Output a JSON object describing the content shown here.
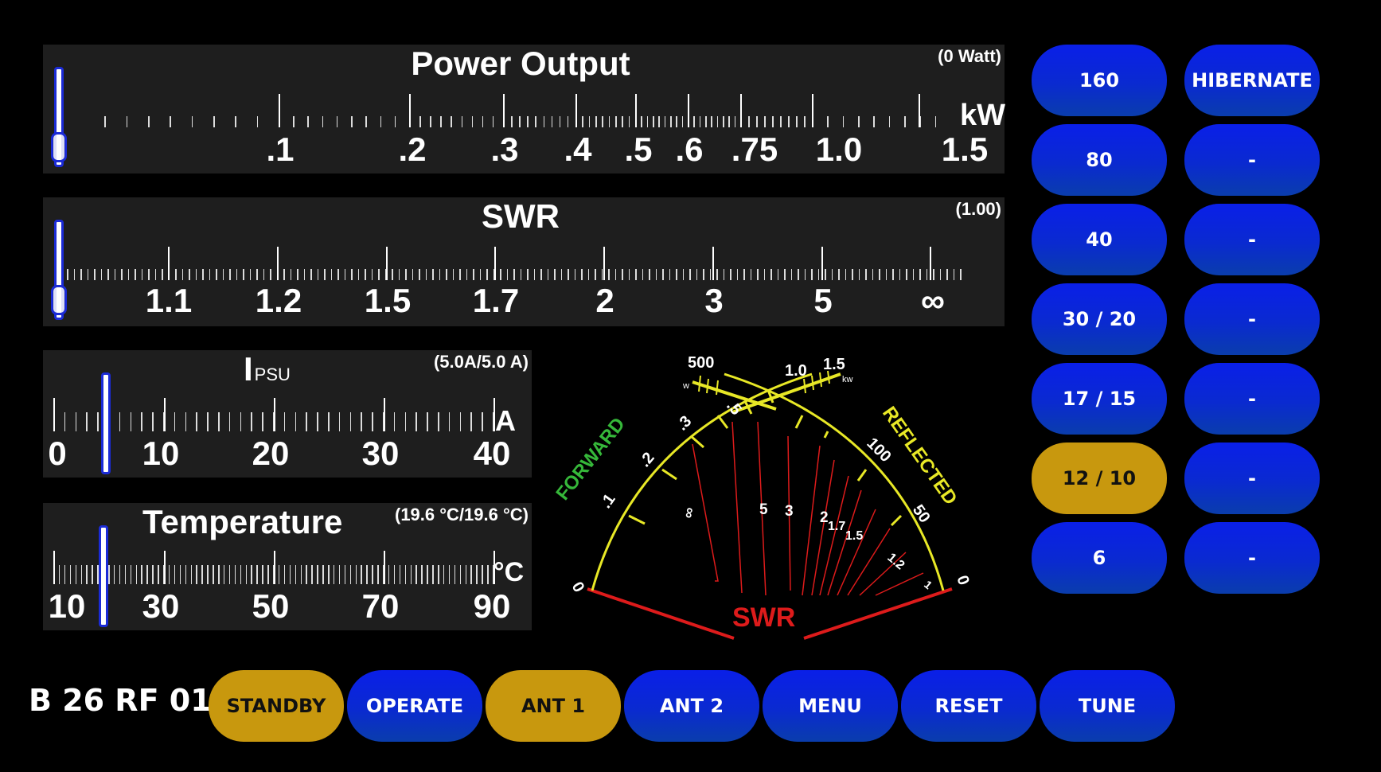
{
  "power": {
    "title": "Power Output",
    "reading": "(0 Watt)",
    "unit": "kW",
    "labels": [
      ".1",
      ".2",
      ".3",
      ".4",
      ".5",
      ".6",
      ".75",
      "1.0",
      "1.5"
    ]
  },
  "swr": {
    "title": "SWR",
    "reading": "(1.00)",
    "labels": [
      "1.1",
      "1.2",
      "1.5",
      "1.7",
      "2",
      "3",
      "5",
      "∞"
    ]
  },
  "ipsu": {
    "title_main": "I",
    "title_sub": "PSU",
    "reading": "(5.0A/5.0 A)",
    "unit": "A",
    "labels": [
      "0",
      "10",
      "20",
      "30",
      "40"
    ]
  },
  "temp": {
    "title": "Temperature",
    "reading": "(19.6 °C/19.6 °C)",
    "unit": "°C",
    "labels": [
      "10",
      "30",
      "50",
      "70",
      "90"
    ]
  },
  "dial": {
    "forward_label": "FORWARD",
    "reflected_label": "REFLECTED",
    "swr_label": "SWR",
    "fwd_scale": [
      "0",
      ".1",
      ".2",
      ".3",
      ".5",
      "1.0",
      "1.5"
    ],
    "fwd_top": [
      "500",
      "w",
      "kw"
    ],
    "ref_scale": [
      "0",
      "50",
      "100"
    ],
    "swr_scale": [
      "∞",
      "5",
      "3",
      "2",
      "1.7",
      "1.5",
      "1.2",
      "1"
    ],
    "colors": {
      "arc": "#e8e826",
      "forward": "#36b83a",
      "swr": "#dd1b1b"
    }
  },
  "bands": [
    "160",
    "80",
    "40",
    "30 / 20",
    "17 / 15",
    "12 / 10",
    "6"
  ],
  "active_band": "12 / 10",
  "side": [
    "HIBERNATE",
    "-",
    "-",
    "-",
    "-",
    "-",
    "-"
  ],
  "status_text": "B 26 RF 01",
  "bottom": [
    "STANDBY",
    "OPERATE",
    "ANT 1",
    "ANT 2",
    "MENU",
    "RESET",
    "TUNE"
  ],
  "bottom_active": [
    "STANDBY",
    "ANT 1"
  ],
  "colors": {
    "button_blue": "#0a22dd",
    "button_active": "#c8980e",
    "panel": "#1e1e1e",
    "needle": "#1b2bd6"
  }
}
